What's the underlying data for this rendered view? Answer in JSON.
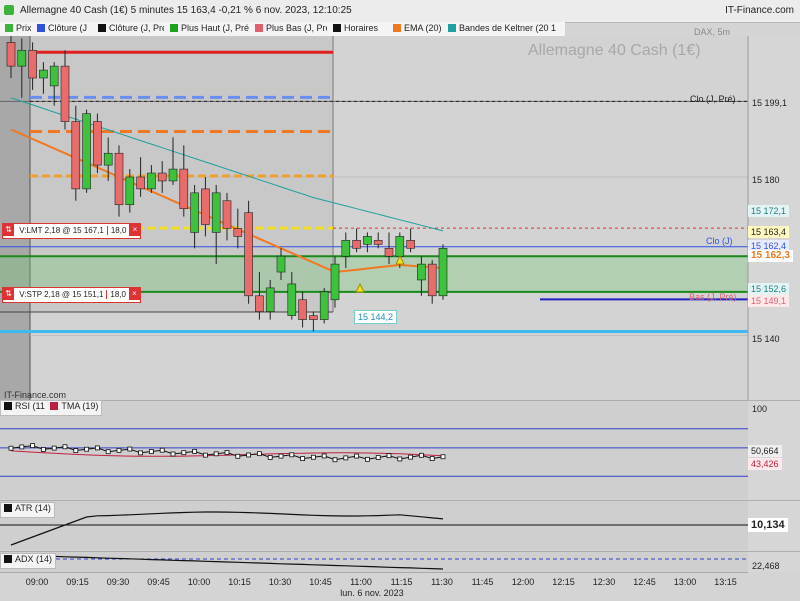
{
  "window": {
    "title": "Allemagne 40 Cash (1€) 5 minutes 15 163,4 -0,21 % 6 nov. 2023, 12:10:25",
    "brand": "IT-Finance.com"
  },
  "chart_header": {
    "instrument": "Allemagne 40 Cash (1€)",
    "symbol": "DAX, 5m",
    "watermark": "IT-Finance.com"
  },
  "legend": [
    {
      "label": "Prix",
      "color": "#3cb43c"
    },
    {
      "label": "Clôture (J",
      "color": "#3050e0"
    },
    {
      "label": "Clôture (J, Pré",
      "color": "#111111"
    },
    {
      "label": "Plus Haut (J, Pré",
      "color": "#20a020"
    },
    {
      "label": "Plus Bas (J, Pré",
      "color": "#e06070"
    },
    {
      "label": "Horaires",
      "color": "#111111"
    },
    {
      "label": "EMA (20)",
      "color": "#f07820"
    },
    {
      "label": "Bandes de Keltner (20 1",
      "color": "#20a0a0"
    }
  ],
  "colors": {
    "up": "#3ec23e",
    "down": "#e86c6c",
    "ema": "#f07820",
    "keltner": "#20a0a0"
  },
  "price_axis": {
    "ticks": [
      "15 180",
      "15 140",
      "100"
    ],
    "labels": {
      "clo_prev": "15 199,1",
      "keltner_up": "15 172,1",
      "order_limit": "15 163,4",
      "clo_j": "15 162,4",
      "last": "15 162,3",
      "keltner_dn": "15 152,6",
      "bas_prev": "15 149,1"
    }
  },
  "annotations": {
    "clo_prev": "Clo (J, Pré)",
    "clo_j": "Clo (J)",
    "bas_prev": "Bas (J, Pré)",
    "low_marker": "15 144,2"
  },
  "orders": {
    "limit": {
      "text": "V:LMT  2,18 @ 15 167,1",
      "qty": "18,0"
    },
    "stop": {
      "text": "V:STP  2,18 @ 15 151,1",
      "qty": "18,0"
    }
  },
  "panels": {
    "rsi": {
      "legend": [
        "RSI (11",
        "TMA (19)"
      ],
      "values": [
        "50,664",
        "43,426"
      ]
    },
    "atr": {
      "legend": "ATR (14)",
      "value": "10,134"
    },
    "adx": {
      "legend": "ADX (14)",
      "value": "22,468"
    }
  },
  "time_axis": {
    "labels": [
      "09:00",
      "09:15",
      "09:30",
      "09:45",
      "10:00",
      "10:15",
      "10:30",
      "10:45",
      "11:00",
      "11:15",
      "11:30",
      "11:45",
      "12:00",
      "12:15",
      "12:30",
      "12:45",
      "13:00",
      "13:15"
    ],
    "date": "lun. 6 nov. 2023"
  },
  "chart_data": {
    "type": "candlestick",
    "interval": "5m",
    "candles": [
      {
        "t": "08:50",
        "o": 15214,
        "h": 15216,
        "l": 15205,
        "c": 15208
      },
      {
        "t": "08:55",
        "o": 15208,
        "h": 15215,
        "l": 15200,
        "c": 15212
      },
      {
        "t": "09:00",
        "o": 15212,
        "h": 15214,
        "l": 15202,
        "c": 15205
      },
      {
        "t": "09:05",
        "o": 15205,
        "h": 15209,
        "l": 15201,
        "c": 15207
      },
      {
        "t": "09:10",
        "o": 15203,
        "h": 15209,
        "l": 15198,
        "c": 15208
      },
      {
        "t": "09:15",
        "o": 15208,
        "h": 15212,
        "l": 15192,
        "c": 15194
      },
      {
        "t": "09:20",
        "o": 15194,
        "h": 15198,
        "l": 15174,
        "c": 15177
      },
      {
        "t": "09:25",
        "o": 15177,
        "h": 15197,
        "l": 15176,
        "c": 15196
      },
      {
        "t": "09:30",
        "o": 15194,
        "h": 15196,
        "l": 15181,
        "c": 15183
      },
      {
        "t": "09:35",
        "o": 15183,
        "h": 15190,
        "l": 15179,
        "c": 15186
      },
      {
        "t": "09:40",
        "o": 15186,
        "h": 15188,
        "l": 15170,
        "c": 15173
      },
      {
        "t": "09:45",
        "o": 15173,
        "h": 15182,
        "l": 15171,
        "c": 15180
      },
      {
        "t": "09:50",
        "o": 15180,
        "h": 15185,
        "l": 15175,
        "c": 15177
      },
      {
        "t": "09:55",
        "o": 15177,
        "h": 15183,
        "l": 15176,
        "c": 15181
      },
      {
        "t": "10:00",
        "o": 15181,
        "h": 15184,
        "l": 15176,
        "c": 15179
      },
      {
        "t": "10:05",
        "o": 15179,
        "h": 15190,
        "l": 15178,
        "c": 15182
      },
      {
        "t": "10:10",
        "o": 15182,
        "h": 15188,
        "l": 15170,
        "c": 15172
      },
      {
        "t": "10:15",
        "o": 15166,
        "h": 15178,
        "l": 15162,
        "c": 15176
      },
      {
        "t": "10:20",
        "o": 15177,
        "h": 15180,
        "l": 15165,
        "c": 15168
      },
      {
        "t": "10:25",
        "o": 15166,
        "h": 15178,
        "l": 15158,
        "c": 15176
      },
      {
        "t": "10:30",
        "o": 15174,
        "h": 15176,
        "l": 15164,
        "c": 15167
      },
      {
        "t": "10:35",
        "o": 15167,
        "h": 15172,
        "l": 15162,
        "c": 15165
      },
      {
        "t": "10:40",
        "o": 15171,
        "h": 15174,
        "l": 15148,
        "c": 15150
      },
      {
        "t": "10:45",
        "o": 15150,
        "h": 15156,
        "l": 15144,
        "c": 15146
      },
      {
        "t": "10:50",
        "o": 15146,
        "h": 15154,
        "l": 15144,
        "c": 15152
      },
      {
        "t": "10:55",
        "o": 15156,
        "h": 15162,
        "l": 15154,
        "c": 15160
      },
      {
        "t": "11:00",
        "o": 15145,
        "h": 15156,
        "l": 15144,
        "c": 15153
      },
      {
        "t": "11:05",
        "o": 15149,
        "h": 15151,
        "l": 15142,
        "c": 15144
      },
      {
        "t": "11:10",
        "o": 15145,
        "h": 15146,
        "l": 15141,
        "c": 15144
      },
      {
        "t": "11:15",
        "o": 15144,
        "h": 15152,
        "l": 15143,
        "c": 15151
      },
      {
        "t": "11:20",
        "o": 15149,
        "h": 15160,
        "l": 15147,
        "c": 15158
      },
      {
        "t": "11:25",
        "o": 15160,
        "h": 15166,
        "l": 15157,
        "c": 15164
      },
      {
        "t": "11:30",
        "o": 15164,
        "h": 15167,
        "l": 15161,
        "c": 15162
      },
      {
        "t": "11:35",
        "o": 15163,
        "h": 15166,
        "l": 15161,
        "c": 15165
      },
      {
        "t": "11:40",
        "o": 15164,
        "h": 15166,
        "l": 15162,
        "c": 15163
      },
      {
        "t": "11:45",
        "o": 15162,
        "h": 15166,
        "l": 15158,
        "c": 15160
      },
      {
        "t": "11:50",
        "o": 15160,
        "h": 15166,
        "l": 15157,
        "c": 15165
      },
      {
        "t": "11:55",
        "o": 15164,
        "h": 15167,
        "l": 15161,
        "c": 15162
      },
      {
        "t": "12:00",
        "o": 15154,
        "h": 15160,
        "l": 15150,
        "c": 15158
      },
      {
        "t": "12:05",
        "o": 15158,
        "h": 15159,
        "l": 15148,
        "c": 15150
      },
      {
        "t": "12:10",
        "o": 15150,
        "h": 15163,
        "l": 15149,
        "c": 15162
      }
    ],
    "levels": {
      "session_high": 15212,
      "clo_prev": 15199.1,
      "high_prev": 15191,
      "mid_level": 15180,
      "keltner_up_last": 15172.1,
      "order_limit": 15167.1,
      "clo_j": 15162.4,
      "last": 15162.3,
      "keltner_dn_last": 15152.6,
      "order_stop": 15151.1,
      "bas_prev": 15149.1,
      "low_marker": 15144.2,
      "range_low": 15141
    },
    "rsi_ylim": [
      0,
      100
    ],
    "rsi_last": 50.664,
    "tma_last": 43.426,
    "atr_last": 10.134,
    "adx_last": 22.468,
    "ylim": [
      15130,
      15215
    ]
  }
}
